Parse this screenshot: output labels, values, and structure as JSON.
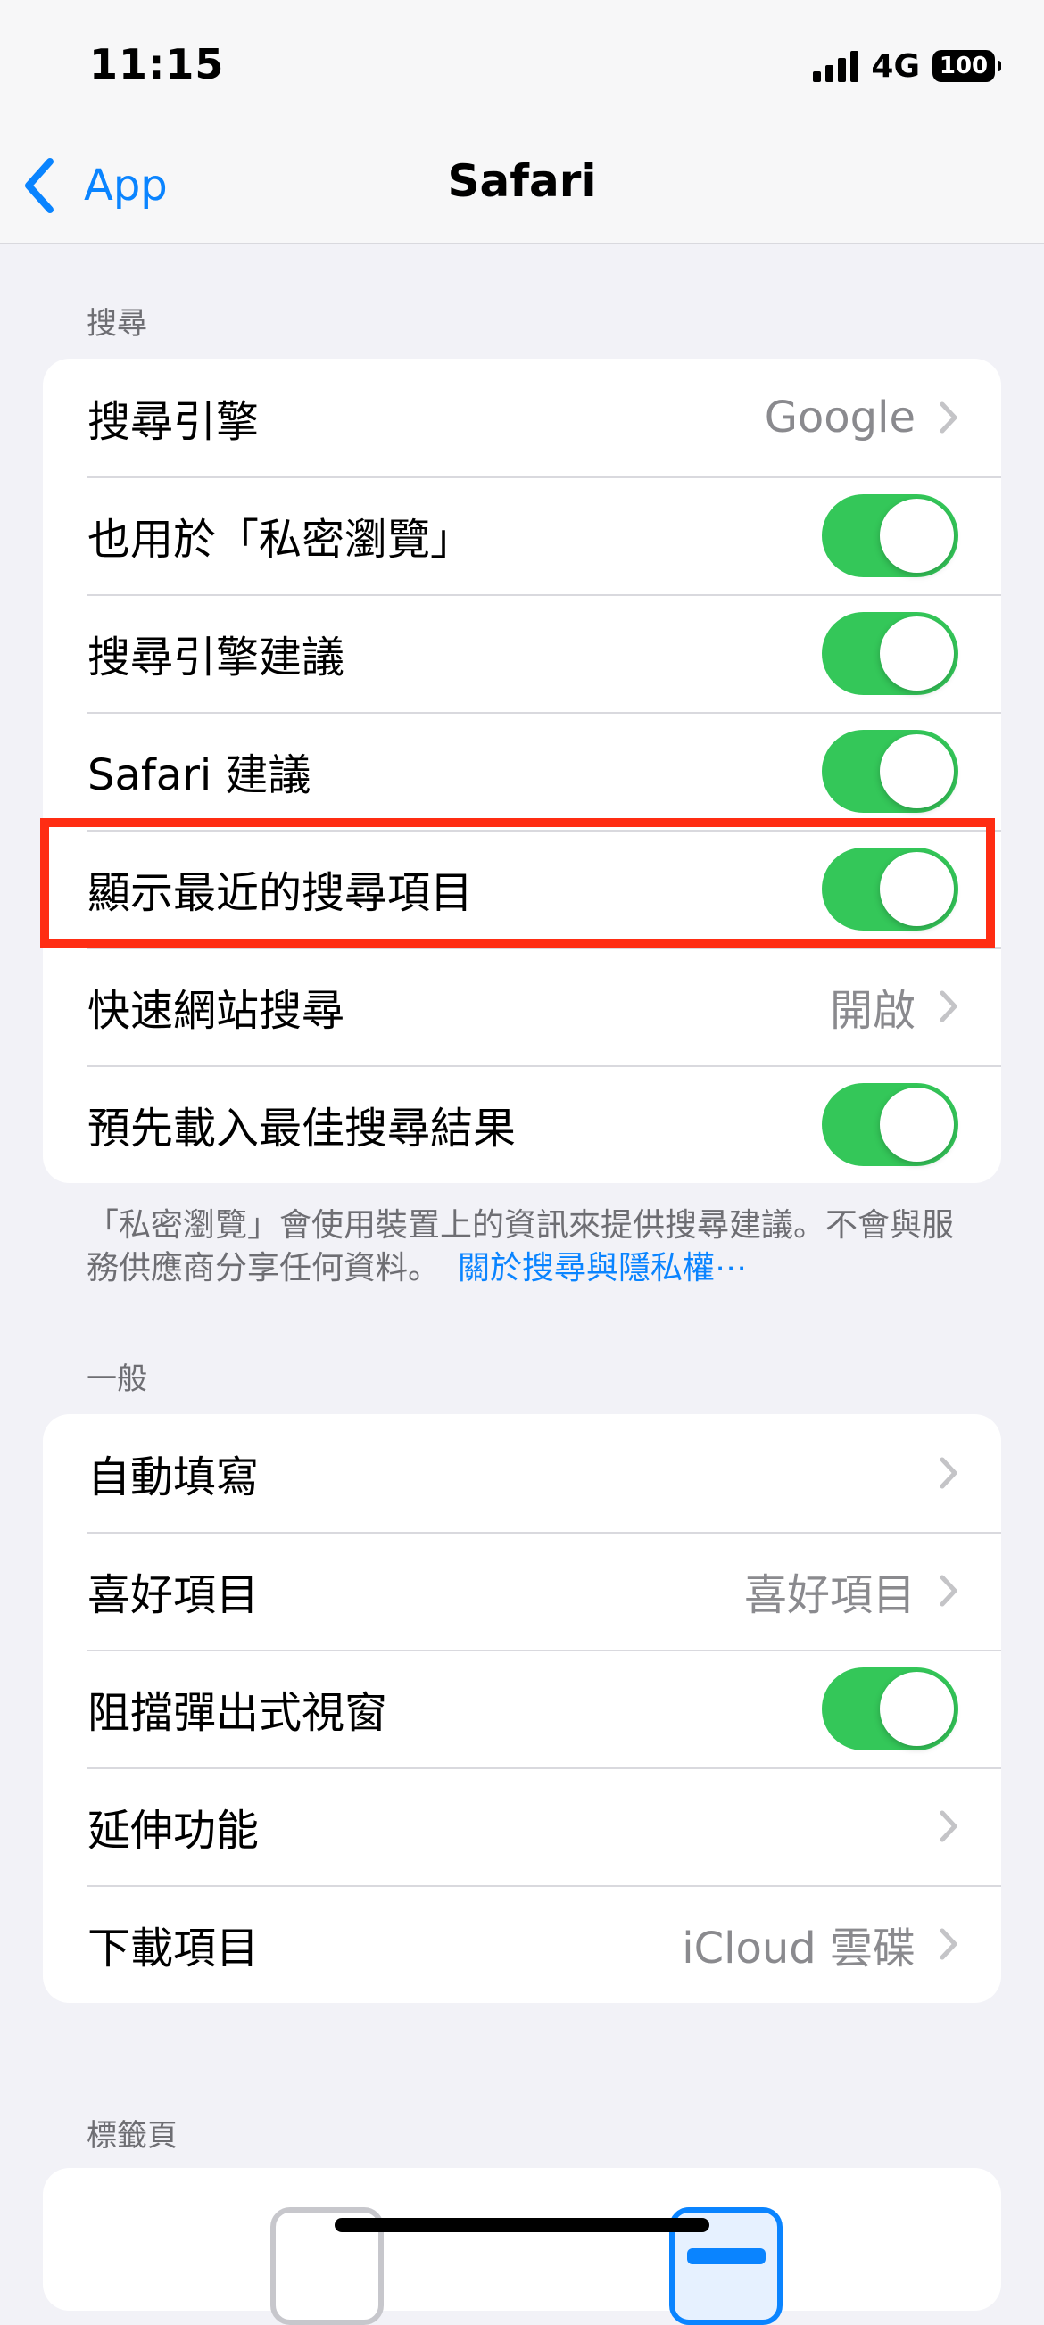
{
  "status_bar": {
    "time": "11:15",
    "network": "4G",
    "battery": "100"
  },
  "nav": {
    "back_label": "App",
    "title": "Safari"
  },
  "search_section": {
    "header": "搜尋",
    "rows": [
      {
        "label": "搜尋引擎",
        "value": "Google"
      },
      {
        "label": "也用於「私密瀏覽」",
        "toggle": true
      },
      {
        "label": "搜尋引擎建議",
        "toggle": true
      },
      {
        "label": "Safari 建議",
        "toggle": true
      },
      {
        "label": "顯示最近的搜尋項目",
        "toggle": true
      },
      {
        "label": "快速網站搜尋",
        "value": "開啟"
      },
      {
        "label": "預先載入最佳搜尋結果",
        "toggle": true
      }
    ],
    "footnote": "「私密瀏覽」會使用裝置上的資訊來提供搜尋建議。不會與服務供應商分享任何資料。",
    "footnote_link": "關於搜尋與隱私權⋯"
  },
  "general_section": {
    "header": "一般",
    "rows": [
      {
        "label": "自動填寫"
      },
      {
        "label": "喜好項目",
        "value": "喜好項目"
      },
      {
        "label": "阻擋彈出式視窗",
        "toggle": true
      },
      {
        "label": "延伸功能"
      },
      {
        "label": "下載項目",
        "value": "iCloud 雲碟"
      }
    ]
  },
  "tabs_section": {
    "header": "標籤頁"
  },
  "colors": {
    "accent": "#0a84ff",
    "toggle_on": "#34c759",
    "highlight": "#ff2d13"
  }
}
